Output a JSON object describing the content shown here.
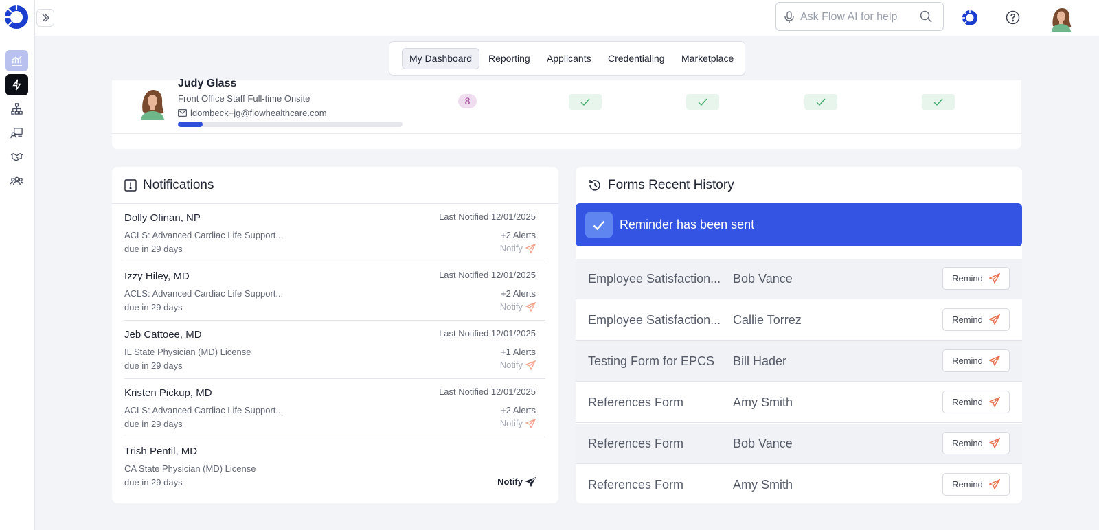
{
  "colors": {
    "brand": "#1a3ccf",
    "accent": "#3454e4",
    "notify_icon": "#f4a28c",
    "remind_icon": "#e8714f",
    "check": "#3fae6a"
  },
  "topbar": {
    "search_placeholder": "Ask Flow AI for help"
  },
  "nav": {
    "tabs": [
      {
        "label": "My Dashboard",
        "active": true
      },
      {
        "label": "Reporting",
        "active": false
      },
      {
        "label": "Applicants",
        "active": false
      },
      {
        "label": "Credentialing",
        "active": false
      },
      {
        "label": "Marketplace",
        "active": false
      }
    ]
  },
  "sidebar": {
    "items": [
      {
        "icon": "chart-icon",
        "active": true
      },
      {
        "icon": "lightning-icon",
        "active": false
      },
      {
        "icon": "org-chart-icon",
        "active": false
      },
      {
        "icon": "applicant-icon",
        "active": false
      },
      {
        "icon": "handshake-icon",
        "active": false
      },
      {
        "icon": "users-icon",
        "active": false
      }
    ]
  },
  "user_row": {
    "name": "Judy Glass",
    "role": "Front Office Staff Full-time Onsite",
    "email": "ldombeck+jg@flowhealthcare.com",
    "progress": 0.11,
    "count": "8"
  },
  "notifications": {
    "title": "Notifications",
    "items": [
      {
        "name": "Dolly Ofinan, NP",
        "desc": "ACLS: Advanced Cardiac Life Support...",
        "due": "due in 29 days",
        "last": "Last Notified 12/01/2025",
        "alerts": "+2 Alerts",
        "notify": "Notify"
      },
      {
        "name": "Izzy Hiley, MD",
        "desc": "ACLS: Advanced Cardiac Life Support...",
        "due": "due in 29 days",
        "last": "Last Notified 12/01/2025",
        "alerts": "+2 Alerts",
        "notify": "Notify"
      },
      {
        "name": "Jeb Cattoee, MD",
        "desc": "IL State Physician (MD) License",
        "due": "due in 29 days",
        "last": "Last Notified 12/01/2025",
        "alerts": "+1 Alerts",
        "notify": "Notify"
      },
      {
        "name": "Kristen Pickup, MD",
        "desc": "ACLS: Advanced Cardiac Life Support...",
        "due": "due in 29 days",
        "last": "Last Notified 12/01/2025",
        "alerts": "+2 Alerts",
        "notify": "Notify"
      },
      {
        "name": "Trish Pentil, MD",
        "desc": "CA State Physician (MD) License",
        "due": "due in 29 days",
        "last": "",
        "alerts": "",
        "notify": "Notify"
      }
    ]
  },
  "forms_history": {
    "title": "Forms Recent History",
    "banner": "Reminder has been sent",
    "remind_label": "Remind",
    "rows": [
      {
        "form": "Employee Satisfaction...",
        "person": "Bob Vance"
      },
      {
        "form": "Employee Satisfaction...",
        "person": "Callie Torrez"
      },
      {
        "form": "Testing Form for EPCS",
        "person": "Bill Hader"
      },
      {
        "form": "References Form",
        "person": "Amy Smith"
      },
      {
        "form": "References Form",
        "person": "Bob Vance"
      },
      {
        "form": "References Form",
        "person": "Amy Smith"
      }
    ]
  }
}
